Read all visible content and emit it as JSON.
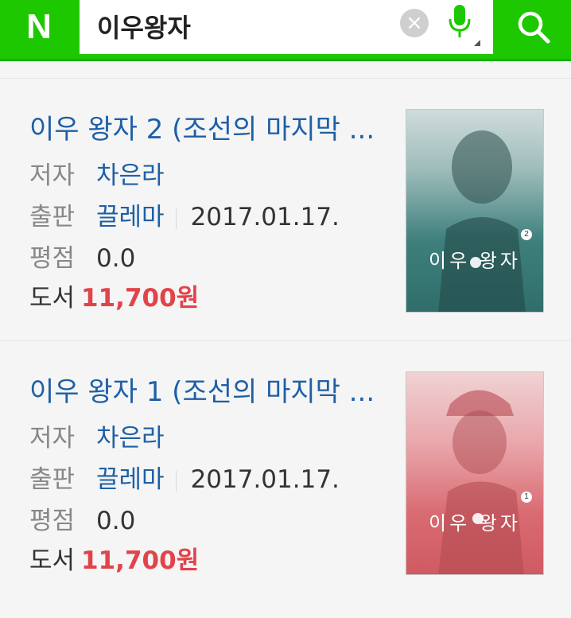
{
  "header": {
    "logo": "N",
    "query": "이우왕자",
    "clear_symbol": "×"
  },
  "results": [
    {
      "title": "이우 왕자 2 (조선의 마지막 ...",
      "author_label": "저자",
      "author": "차은라",
      "publisher_label": "출판",
      "publisher": "끌레마",
      "date": "2017.01.17.",
      "rating_label": "평점",
      "rating": "0.0",
      "price_label": "도서",
      "price": "11,700",
      "currency": "원",
      "cover": {
        "title": "이우 왕자",
        "volume": "2",
        "tint": "#3e7f7c"
      }
    },
    {
      "title": "이우 왕자 1 (조선의 마지막 ...",
      "author_label": "저자",
      "author": "차은라",
      "publisher_label": "출판",
      "publisher": "끌레마",
      "date": "2017.01.17.",
      "rating_label": "평점",
      "rating": "0.0",
      "price_label": "도서",
      "price": "11,700",
      "currency": "원",
      "cover": {
        "title": "이우 왕자",
        "volume": "1",
        "tint": "#d96b72"
      }
    }
  ],
  "colors": {
    "brand": "#1ec800",
    "link": "#1f5fa6",
    "price": "#e2434a"
  },
  "icons": [
    "mic-icon",
    "search-icon",
    "clear-icon"
  ]
}
